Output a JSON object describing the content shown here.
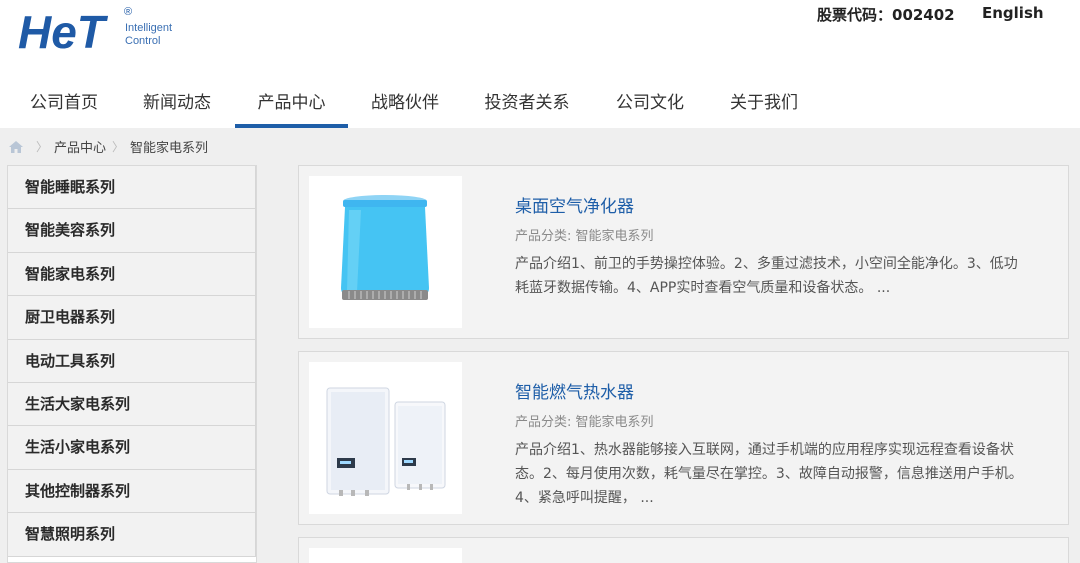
{
  "brand": {
    "logo_text": "HeT",
    "logo_registered": "®",
    "logo_subtitle_line1": "Intelligent",
    "logo_subtitle_line2": "Control",
    "accent_color": "#1e5ea8"
  },
  "header": {
    "stock_label": "股票代码：002402",
    "language_link": "English"
  },
  "nav": {
    "items": [
      {
        "label": "公司首页"
      },
      {
        "label": "新闻动态"
      },
      {
        "label": "产品中心",
        "active": true
      },
      {
        "label": "战略伙伴"
      },
      {
        "label": "投资者关系"
      },
      {
        "label": "公司文化"
      },
      {
        "label": "关于我们"
      }
    ]
  },
  "breadcrumb": {
    "home_icon": "home-icon",
    "separator": "〉",
    "items": [
      "产品中心",
      "智能家电系列"
    ]
  },
  "sidebar": {
    "items": [
      {
        "label": "智能睡眠系列"
      },
      {
        "label": "智能美容系列"
      },
      {
        "label": "智能家电系列"
      },
      {
        "label": "厨卫电器系列"
      },
      {
        "label": "电动工具系列"
      },
      {
        "label": "生活大家电系列"
      },
      {
        "label": "生活小家电系列"
      },
      {
        "label": "其他控制器系列"
      },
      {
        "label": "智慧照明系列"
      }
    ]
  },
  "products": [
    {
      "title": "桌面空气净化器",
      "category": "产品分类: 智能家电系列",
      "description": "产品介绍1、前卫的手势操控体验。2、多重过滤技术，小空间全能净化。3、低功耗蓝牙数据传输。4、APP实时查看空气质量和设备状态。 ..."
    },
    {
      "title": "智能燃气热水器",
      "category": "产品分类: 智能家电系列",
      "description": "产品介绍1、热水器能够接入互联网，通过手机端的应用程序实现远程查看设备状态。2、每月使用次数，耗气量尽在掌控。3、故障自动报警，信息推送用户手机。4、紧急呼叫提醒， ..."
    }
  ]
}
